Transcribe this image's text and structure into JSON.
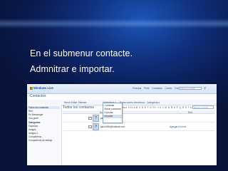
{
  "slide": {
    "line1": "En el submenur contacte.",
    "line2": "Admnitrar e importar."
  },
  "app": {
    "brand": "Windows Live",
    "page_title": "Contactos",
    "topnav": [
      "Principal",
      "Perfil",
      "Contactos",
      "Correo",
      "Fotos",
      "Más"
    ],
    "search_placeholder": "Buscar en la Web",
    "toolbar": [
      "Nuevo",
      "Editar",
      "Eliminar",
      "Administrar ▾",
      "Enviar correo electrónico",
      "Categorías ▾"
    ],
    "sidebar": [
      "Todos los contactos",
      "Red",
      "En Messenger",
      "Con perfil",
      "Categorías",
      "Favoritos",
      "Amigos",
      "Amigos 2",
      "Compañeros",
      "Compañeros de trabajo"
    ],
    "manage_menu": [
      "Combinar",
      "Borrar contactos",
      "Exportar",
      "Importar"
    ],
    "list_title": "Todos los contactos",
    "alphabet": "Todos 123 A B C D E F G H I J K L M N Ñ O P Q R S T U V W X Y Z",
    "list_search_placeholder": "Buscar en la lista",
    "columns": [
      "Nombre",
      "Red"
    ],
    "rows": [
      {
        "name": "jair123456",
        "extra": ""
      },
      {
        "name": "jairlo1984@hotmail.com",
        "extra": "Agregar a tu red"
      }
    ]
  }
}
